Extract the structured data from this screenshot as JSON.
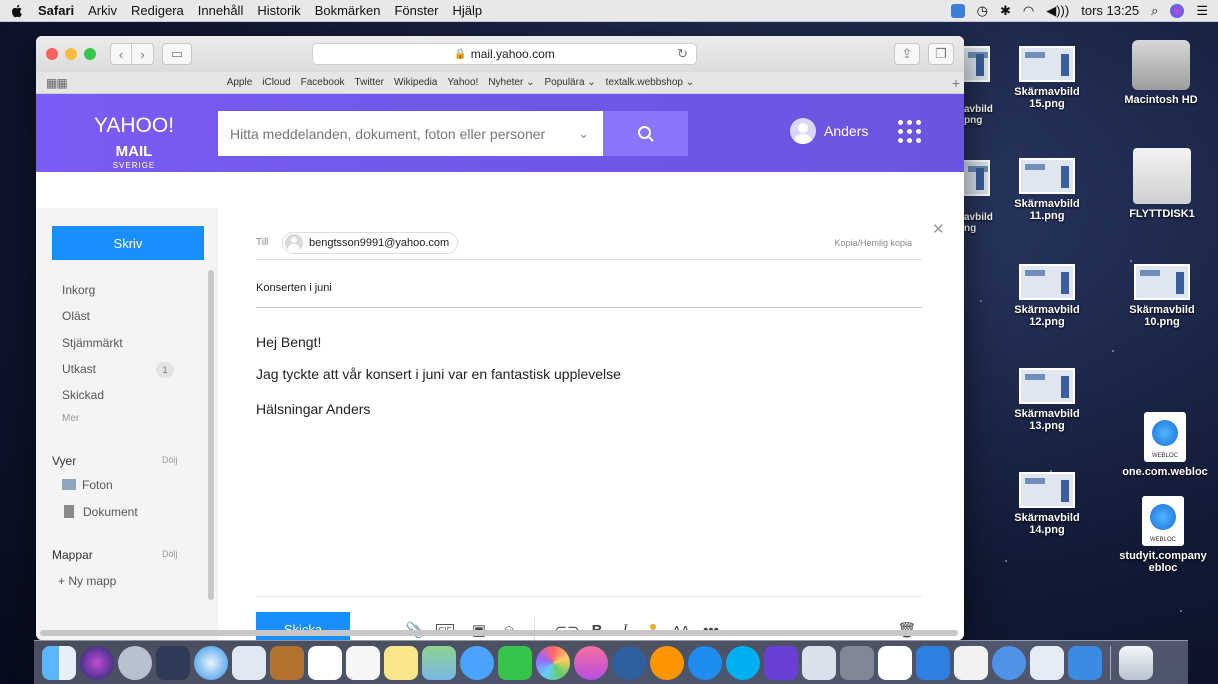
{
  "menubar": {
    "app": "Safari",
    "items": [
      "Arkiv",
      "Redigera",
      "Innehåll",
      "Historik",
      "Bokmärken",
      "Fönster",
      "Hjälp"
    ],
    "clock": "tors 13:25"
  },
  "browser": {
    "url": "mail.yahoo.com",
    "favorites": [
      "Apple",
      "iCloud",
      "Facebook",
      "Twitter",
      "Wikipedia",
      "Yahoo!",
      "Nyheter ⌄",
      "Populära ⌄",
      "textalk.webbshop ⌄"
    ]
  },
  "yahoo": {
    "logo_main": "YAHOO!",
    "logo_mail": "MAIL",
    "logo_sub": "SVERIGE",
    "search_placeholder": "Hitta meddelanden, dokument, foton eller personer",
    "user_name": "Anders"
  },
  "sidebar": {
    "compose": "Skriv",
    "folders": [
      "Inkorg",
      "Oläst",
      "Stjämmärkt",
      "Utkast",
      "Skickad"
    ],
    "drafts_count": "1",
    "more": "Mer",
    "views_title": "Vyer",
    "hide": "Dölj",
    "views": [
      "Foton",
      "Dokument"
    ],
    "folders_title": "Mappar",
    "new_folder": "+ Ny mapp"
  },
  "compose": {
    "to_label": "Till",
    "recipient": "bengtsson9991@yahoo.com",
    "cc_label": "Kopia/Hemlig kopia",
    "subject": "Konserten i juni",
    "body": [
      "Hej Bengt!",
      "Jag tyckte att vår konsert i juni var en fantastisk upplevelse",
      "Hälsningar Anders"
    ],
    "send": "Skicka"
  },
  "desktop": {
    "icons": [
      {
        "label": "Skärmavbild 15.png"
      },
      {
        "label": "Macintosh HD"
      },
      {
        "label": "Skärmavbild 11.png"
      },
      {
        "label": "FLYTTDISK1"
      },
      {
        "label": "Skärmavbild 12.png"
      },
      {
        "label": "Skärmavbild 10.png"
      },
      {
        "label": "Skärmavbild 13.png"
      },
      {
        "label": "one.com.webloc"
      },
      {
        "label": "Skärmavbild 14.png"
      },
      {
        "label": "studyit.company ebloc"
      }
    ],
    "partial": [
      "avbild",
      "png",
      "avbild",
      "ng"
    ],
    "webloc_tag": "WEBLOC"
  },
  "colors": {
    "yahoo_purple": "#7b5cf6",
    "accent_blue": "#188fff"
  }
}
